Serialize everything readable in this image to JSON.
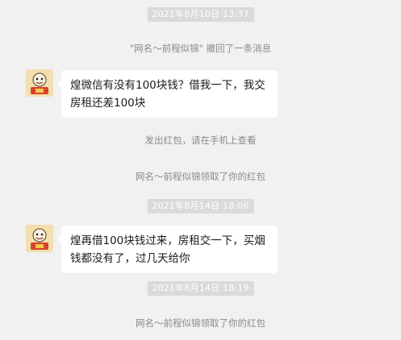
{
  "messages": {
    "ts1": "2021年8月10日 13:37",
    "recall_notice": "\"网名～前程似锦\" 撤回了一条消息",
    "msg1": "煌微信有没有100块钱？借我一下，我交房租还差100块",
    "redpacket_notice": "发出红包，请在手机上查看",
    "claim1": "网名～前程似锦领取了你的红包",
    "ts2": "2021年8月14日 18:06",
    "msg2": "煌再借100块钱过来，房租交一下，买烟钱都没有了，过几天给你",
    "ts3": "2021年8月14日 18:19",
    "claim2": "网名～前程似锦领取了你的红包"
  },
  "icons": {
    "avatar": "cartoon-avatar-icon"
  },
  "colors": {
    "background": "#f1f1f1",
    "timestamp_bg": "#dadada",
    "bubble": "#ffffff",
    "system_text": "#8a8a8a"
  }
}
